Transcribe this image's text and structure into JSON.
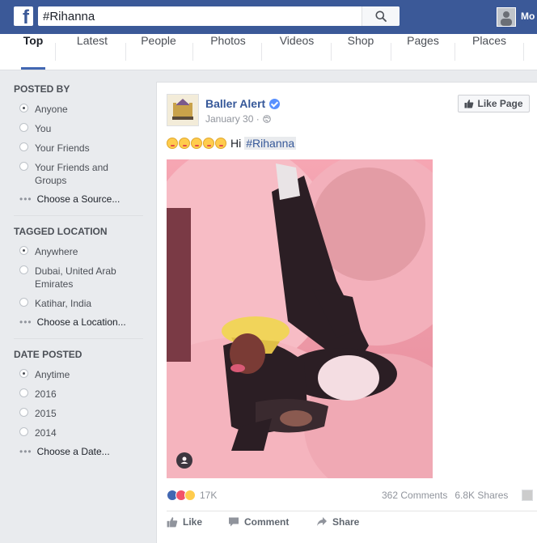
{
  "topbar": {
    "logo_letter": "f",
    "search_value": "#Rihanna",
    "user_name": "Mo"
  },
  "tabs": [
    {
      "label": "Top",
      "active": true
    },
    {
      "label": "Latest"
    },
    {
      "label": "People"
    },
    {
      "label": "Photos"
    },
    {
      "label": "Videos"
    },
    {
      "label": "Shop"
    },
    {
      "label": "Pages"
    },
    {
      "label": "Places"
    }
  ],
  "filters": {
    "posted_by": {
      "title": "POSTED BY",
      "options": [
        "Anyone",
        "You",
        "Your Friends",
        "Your Friends and Groups"
      ],
      "selected": "Anyone",
      "choose": "Choose a Source..."
    },
    "tagged_location": {
      "title": "TAGGED LOCATION",
      "options": [
        "Anywhere",
        "Dubai, United Arab Emirates",
        "Katihar, India"
      ],
      "selected": "Anywhere",
      "choose": "Choose a Location..."
    },
    "date_posted": {
      "title": "DATE POSTED",
      "options": [
        "Anytime",
        "2016",
        "2015",
        "2014"
      ],
      "selected": "Anytime",
      "choose": "Choose a Date..."
    }
  },
  "post": {
    "page_name": "Baller Alert",
    "date": "January 30",
    "date_sep": "·",
    "like_page_label": "Like Page",
    "text_prefix": "Hi",
    "hashtag": "#Rihanna",
    "reactions_count": "17K",
    "comments": "362 Comments",
    "shares": "6.8K Shares",
    "actions": {
      "like": "Like",
      "comment": "Comment",
      "share": "Share"
    }
  },
  "colors": {
    "brand": "#3b5998",
    "link": "#365899",
    "verified": "#5890ff"
  }
}
